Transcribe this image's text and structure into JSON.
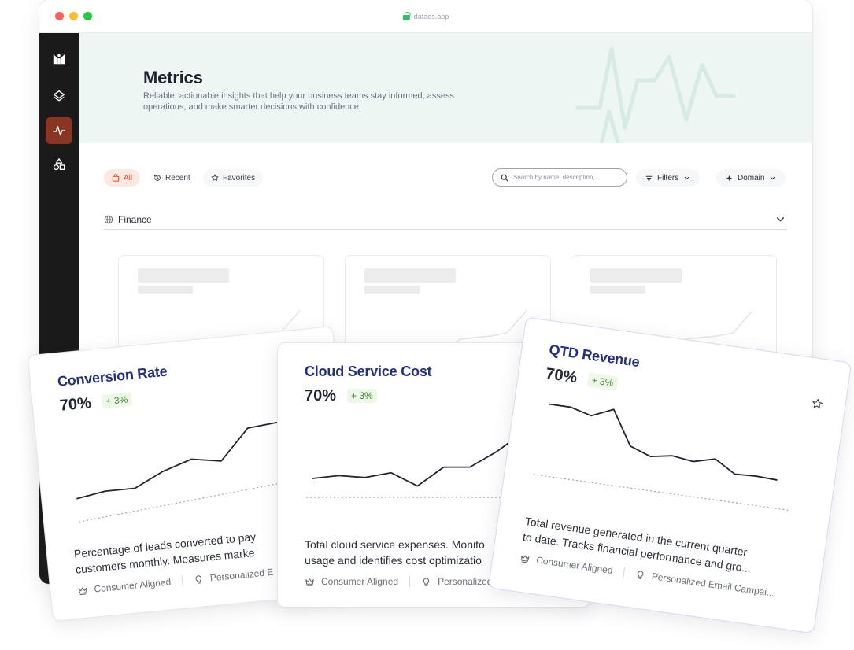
{
  "browser": {
    "url": "dataos.app"
  },
  "sidebar": {
    "items": [
      {
        "icon": "logo-icon"
      },
      {
        "icon": "layers-icon"
      },
      {
        "icon": "activity-icon",
        "active": true
      },
      {
        "icon": "shapes-icon"
      }
    ]
  },
  "header": {
    "title": "Metrics",
    "description": "Reliable, actionable insights that help your business teams stay informed, assess operations, and make smarter decisions with confidence."
  },
  "toolbar": {
    "tabs": [
      {
        "label": "All",
        "icon": "bag-icon",
        "active": true
      },
      {
        "label": "Recent",
        "icon": "history-icon"
      },
      {
        "label": "Favorites",
        "icon": "star-icon"
      }
    ],
    "search_placeholder": "Search by name, description,...",
    "filters_label": "Filters",
    "domain_label": "Domain"
  },
  "section": {
    "label": "Finance",
    "icon": "globe-icon"
  },
  "cards": [
    {
      "title": "Conversion Rate",
      "value": "70%",
      "change": "+ 3%",
      "desc_line1": "Percentage of leads converted to pay",
      "desc_line2": "customers monthly. Measures marke",
      "tag1": "Consumer Aligned",
      "tag2": "Personalized E",
      "series": [
        18,
        23,
        23,
        38,
        48,
        43,
        75,
        78,
        81
      ]
    },
    {
      "title": "Cloud Service Cost",
      "value": "70%",
      "change": "+ 3%",
      "desc_line1": "Total cloud service expenses. Monito",
      "desc_line2": "usage and identifies cost optimizatio",
      "tag1": "Consumer Aligned",
      "tag2": "Personalized E",
      "series": [
        30,
        33,
        31,
        36,
        22,
        42,
        42,
        58,
        78,
        92
      ]
    },
    {
      "title": "QTD Revenue",
      "value": "70%",
      "change": "+ 3%",
      "desc_line1": "Total revenue generated in the current quarter",
      "desc_line2": "to date. Tracks financial performance and gro...",
      "tag1": "Consumer Aligned",
      "tag2": "Personalized Email Campai...",
      "series": [
        86,
        86,
        80,
        90,
        54,
        46,
        50,
        47,
        53,
        40,
        41,
        40
      ]
    }
  ],
  "colors": {
    "accent": "#d4532f",
    "sidebar_active": "#8a3522",
    "card_title": "#23317c",
    "positive": "#3d8a2e"
  }
}
